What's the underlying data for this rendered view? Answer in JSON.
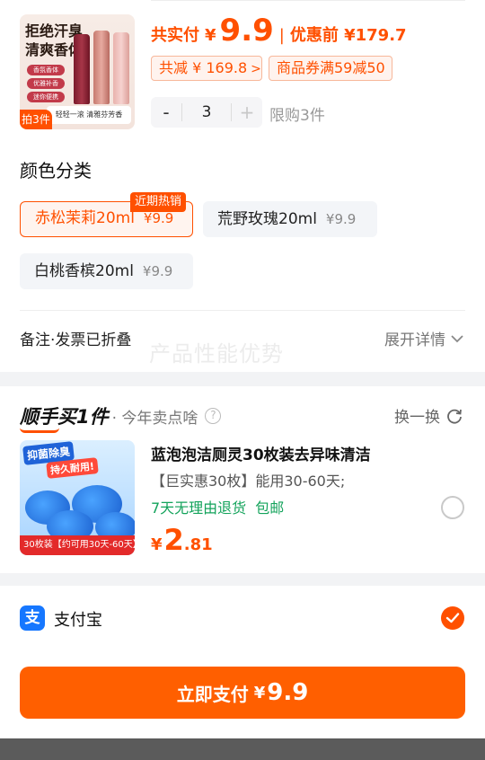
{
  "product": {
    "image_slogan": "拒绝汗臭\n清爽香体",
    "image_chips": [
      "香氛香体",
      "优雅补香",
      "迷你便携"
    ],
    "image_caption": "轻轻一滚 清雅芬芳香",
    "image_qty_tag": "拍3件",
    "price_label": "共实付",
    "currency": "¥",
    "price": "9.9",
    "separator": "|",
    "original_price": "优惠前 ¥179.7",
    "savings_tag": "共减 ¥ 169.8",
    "coupon_tag": "商品券满59减50",
    "quantity": "3",
    "minus": "-",
    "plus": "+",
    "limit_text": "限购3件"
  },
  "variants": {
    "section_title": "颜色分类",
    "hot_badge": "近期热销",
    "options": [
      {
        "name": "赤松茉莉20ml",
        "price": "¥9.9",
        "selected": true
      },
      {
        "name": "荒野玫瑰20ml",
        "price": "¥9.9",
        "selected": false
      },
      {
        "name": "白桃香槟20ml",
        "price": "¥9.9",
        "selected": false
      }
    ]
  },
  "remark": {
    "label": "备注·发票已折叠",
    "expand_label": "展开详情",
    "watermark": "产品性能优势"
  },
  "addon": {
    "brand": "顺手买1件",
    "subtitle": "· 今年卖点啥",
    "help": "?",
    "refresh_label": "换一换",
    "image_banner": "抑菌除臭",
    "image_banner2": "持久耐用!",
    "image_strip": "30枚装【约可用30天-60天】",
    "title": "蓝泡泡洁厕灵30枚装去异味清洁",
    "desc": "【巨实惠30枚】能用30-60天;",
    "service_1": "7天无理由退货",
    "service_2": "包邮",
    "currency": "¥",
    "price_int": "2",
    "price_dec": ".81"
  },
  "payment": {
    "method_icon": "支",
    "method_label": "支付宝",
    "button_label": "立即支付",
    "button_currency": "¥",
    "button_amount": "9.9"
  },
  "colors": {
    "accent": "#ff5000",
    "green": "#13a35b",
    "alipay": "#1677ff"
  }
}
